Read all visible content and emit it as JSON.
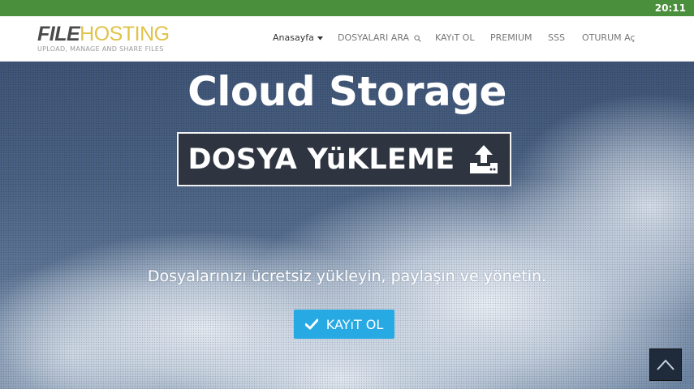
{
  "status_bar": {
    "time": "20:11"
  },
  "logo": {
    "brand_part1": "FILE",
    "brand_part2": "HOSTING",
    "tagline": "UPLOAD, MANAGE AND SHARE FILES"
  },
  "nav": {
    "items": [
      {
        "label": "Anasayfa",
        "icon": "caret-down-icon"
      },
      {
        "label": "DOSYALARI ARA",
        "icon": "search-icon"
      },
      {
        "label": "KAYıT OL"
      },
      {
        "label": "PREMIUM"
      },
      {
        "label": "SSS"
      },
      {
        "label": "OTURUM Aç"
      }
    ]
  },
  "hero": {
    "title": "Cloud Storage",
    "upload_button": {
      "label": "DOSYA YüKLEME",
      "icon": "upload-icon"
    },
    "subtitle": "Dosyalarınızı ücretsiz yükleyin, paylaşın ve yönetin.",
    "register_button": {
      "label": "KAYıT OL",
      "icon": "check-icon"
    }
  },
  "scroll_top": {
    "icon": "chevron-up-icon"
  },
  "colors": {
    "status_bar": "#4a8f3c",
    "accent_blue": "#27a9e3",
    "dark_button": "#2e3440",
    "logo_yellow": "#e0c34a"
  }
}
